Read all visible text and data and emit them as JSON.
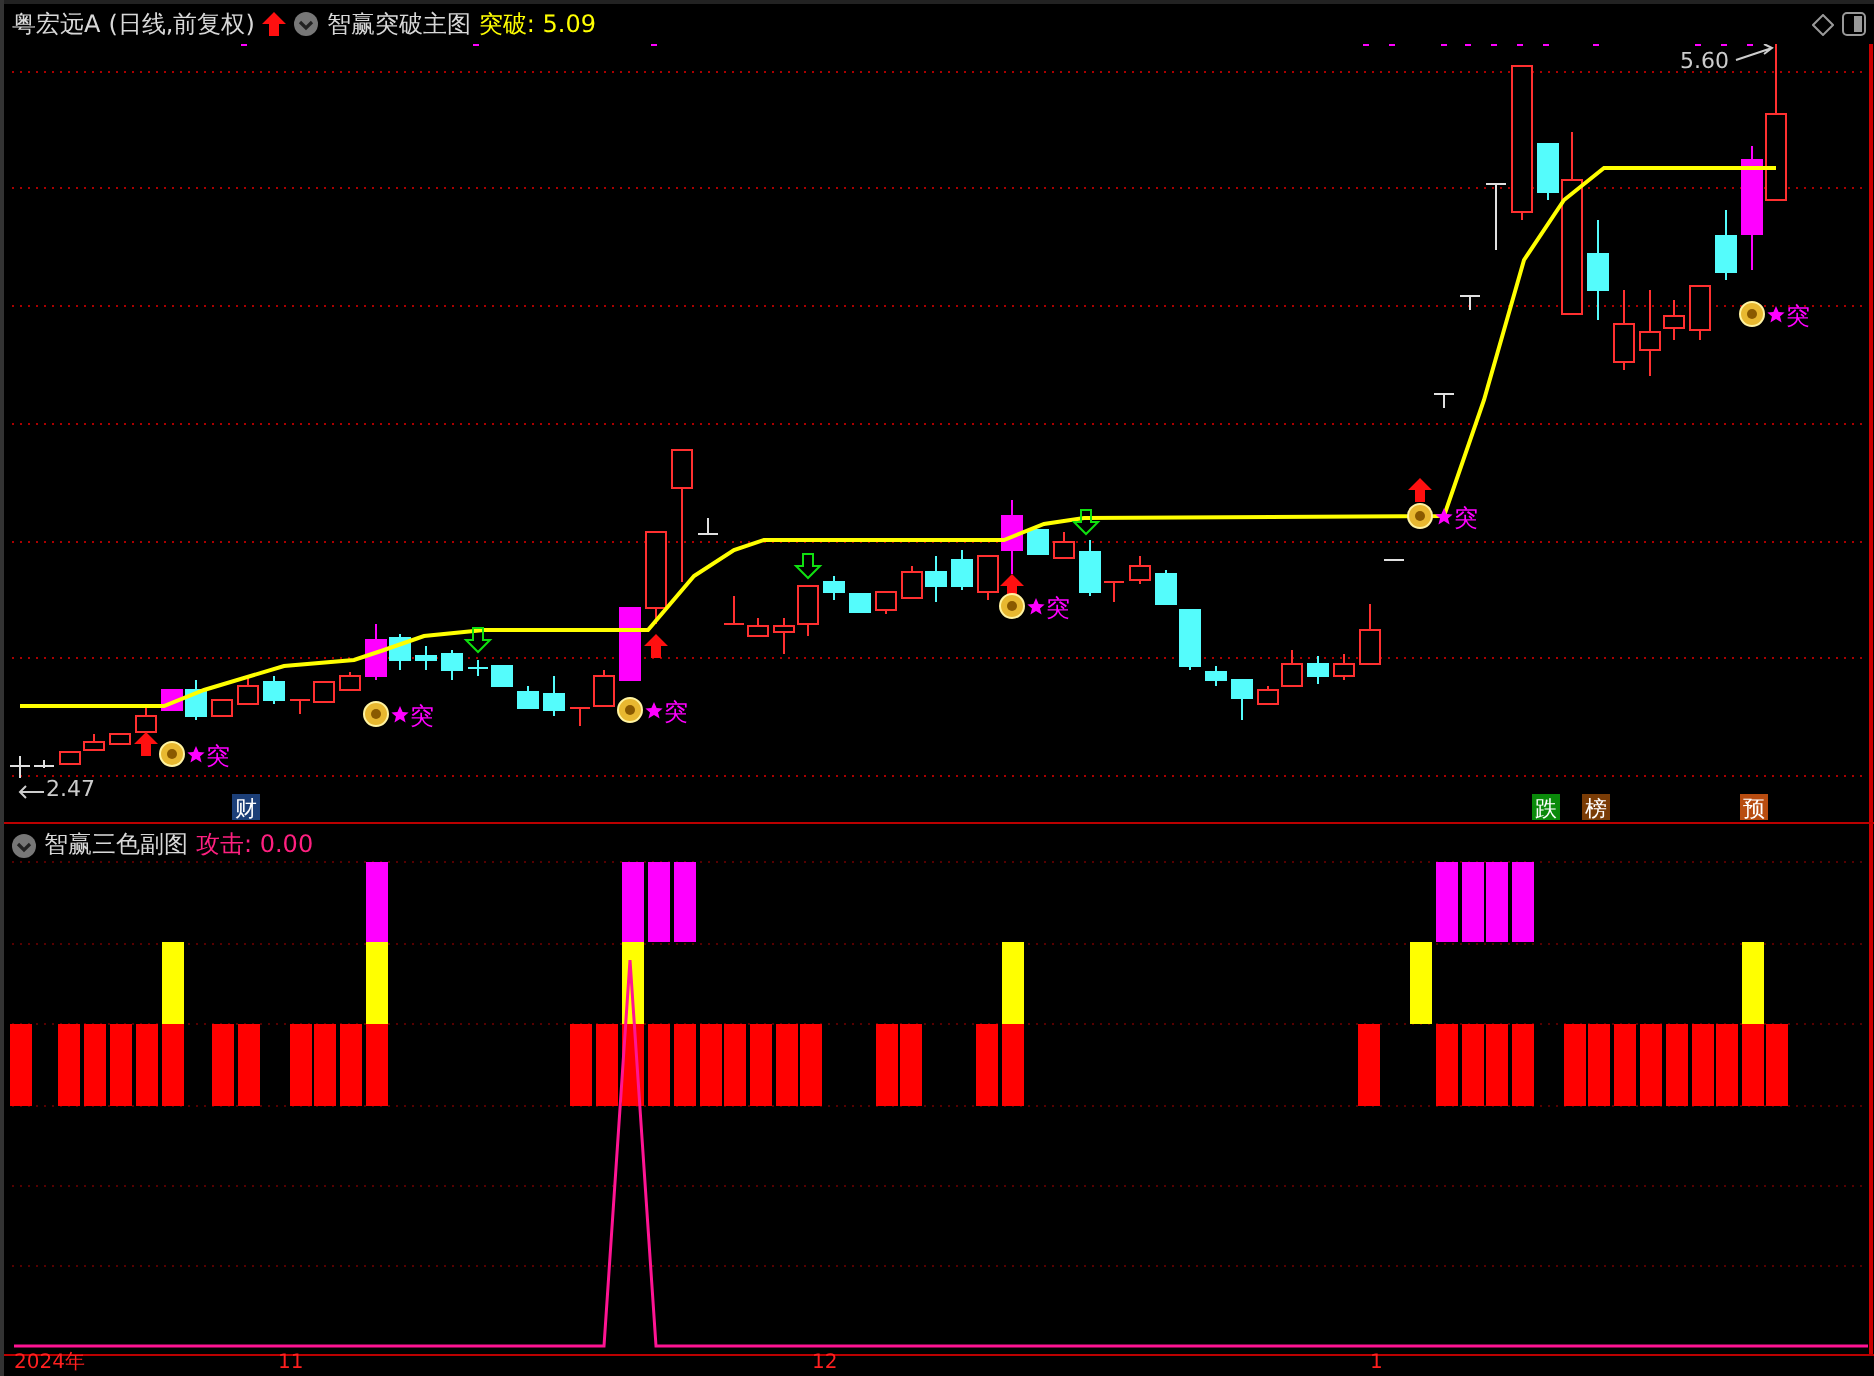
{
  "header": {
    "stock_name": "粤宏远A",
    "period": "(日线,前复权)",
    "indicator": "智赢突破主图",
    "reading": "突破: 5.09"
  },
  "main_chart": {
    "price_high": "5.60",
    "price_low": "2.47",
    "signals": [
      {
        "label": "突"
      },
      {
        "label": "突"
      },
      {
        "label": "突"
      },
      {
        "label": "突"
      },
      {
        "label": "突"
      },
      {
        "label": "突"
      }
    ],
    "events": [
      {
        "label": "财",
        "color": "#1c3f78"
      },
      {
        "label": "跌",
        "color": "#0a8a0a"
      },
      {
        "label": "榜",
        "color": "#7a3c06"
      },
      {
        "label": "预",
        "color": "#b84c10"
      }
    ]
  },
  "sub_chart": {
    "indicator": "智赢三色副图",
    "reading": "攻击: 0.00"
  },
  "time_axis": [
    "2024年",
    "11",
    "12",
    "1"
  ]
}
